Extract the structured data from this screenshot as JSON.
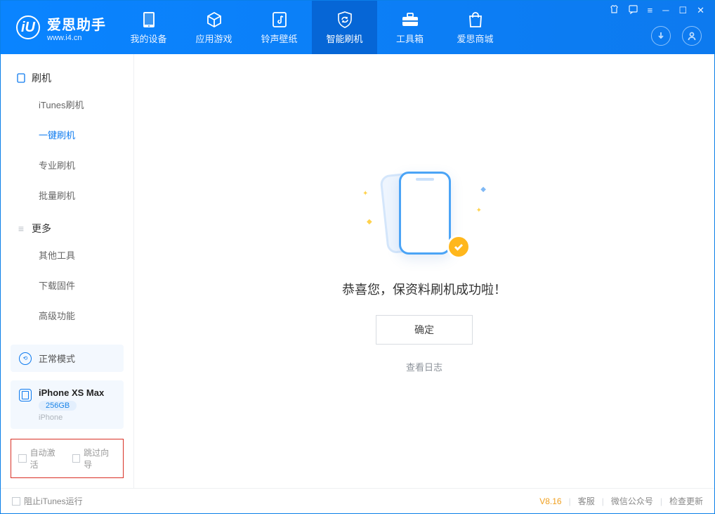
{
  "app": {
    "name": "爱思助手",
    "url": "www.i4.cn",
    "logo_letter": "iU"
  },
  "nav": [
    {
      "label": "我的设备"
    },
    {
      "label": "应用游戏"
    },
    {
      "label": "铃声壁纸"
    },
    {
      "label": "智能刷机",
      "active": true
    },
    {
      "label": "工具箱"
    },
    {
      "label": "爱思商城"
    }
  ],
  "sidebar": {
    "groups": [
      {
        "title": "刷机",
        "items": [
          {
            "label": "iTunes刷机"
          },
          {
            "label": "一键刷机",
            "active": true
          },
          {
            "label": "专业刷机"
          },
          {
            "label": "批量刷机"
          }
        ]
      },
      {
        "title": "更多",
        "items": [
          {
            "label": "其他工具"
          },
          {
            "label": "下载固件"
          },
          {
            "label": "高级功能"
          }
        ]
      }
    ],
    "mode": "正常模式",
    "device": {
      "name": "iPhone XS Max",
      "capacity": "256GB",
      "subtitle": "iPhone"
    },
    "checks": {
      "auto_activate": "自动激活",
      "skip_guide": "跳过向导"
    }
  },
  "main": {
    "success_msg": "恭喜您，保资料刷机成功啦！",
    "ok_btn": "确定",
    "log_link": "查看日志"
  },
  "footer": {
    "block_itunes": "阻止iTunes运行",
    "version": "V8.16",
    "links": [
      "客服",
      "微信公众号",
      "检查更新"
    ]
  }
}
